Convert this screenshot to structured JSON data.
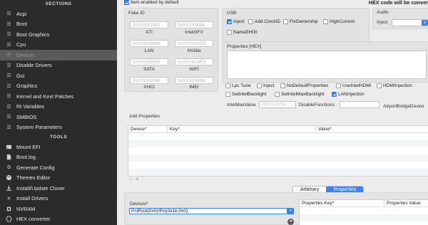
{
  "sidebar": {
    "sections_label": "SECTIONS",
    "tools_label": "TOOLS",
    "items": [
      {
        "label": "Acpi"
      },
      {
        "label": "Boot"
      },
      {
        "label": "Boot Graphics"
      },
      {
        "label": "Cpu"
      },
      {
        "label": "Devices"
      },
      {
        "label": "Disable Drivers"
      },
      {
        "label": "Gui"
      },
      {
        "label": "Graphics"
      },
      {
        "label": "Kernel and Kext Patches"
      },
      {
        "label": "Rt Variables"
      },
      {
        "label": "SMBIOS"
      },
      {
        "label": "System Parameters"
      }
    ],
    "tools": [
      {
        "label": "Mount EFI"
      },
      {
        "label": "Boot.log"
      },
      {
        "label": "Generate Config"
      },
      {
        "label": "Themes Editor"
      },
      {
        "label": "Install/Update Clover"
      },
      {
        "label": "Install Drivers"
      },
      {
        "label": "NVRAM"
      },
      {
        "label": "HEX converter"
      }
    ]
  },
  "header": {
    "item_enabled_label": "Item enabled by default",
    "hex_note": "HEX code will be conver"
  },
  "fake_id": {
    "title": "Fake ID",
    "fields": [
      {
        "placeholder": "0xXXXX1002",
        "label": "ATI"
      },
      {
        "placeholder": "0xXXXX8086",
        "label": "IntelGFX"
      },
      {
        "placeholder": "0xXXXX8086",
        "label": "LAN"
      },
      {
        "placeholder": "0xXXXX10DE",
        "label": "NVidia"
      },
      {
        "placeholder": "0xXXXX8086",
        "label": "SATA"
      },
      {
        "placeholder": "0xXXXX14E4",
        "label": "WIFI"
      },
      {
        "placeholder": "0xXXXX8086",
        "label": "XHCI"
      },
      {
        "placeholder": "0xXXXX8086",
        "label": "IMEI"
      }
    ]
  },
  "usb": {
    "title": "USB",
    "options": [
      {
        "label": "Inject",
        "checked": true
      },
      {
        "label": "Add ClockID",
        "checked": false
      },
      {
        "label": "FixOwnership",
        "checked": false
      },
      {
        "label": "HighCurrent",
        "checked": false
      },
      {
        "label": "NameEH00",
        "checked": false
      }
    ]
  },
  "audio": {
    "title": "Audio",
    "inject_label": "Inject"
  },
  "properties_hex": {
    "title": "Properties [HEX]"
  },
  "device_options": {
    "row1": [
      {
        "label": "Lpc Tune",
        "checked": false
      },
      {
        "label": "Inject",
        "checked": false
      },
      {
        "label": "NoDefaultProperties",
        "checked": false
      },
      {
        "label": "UseIntelHDMI",
        "checked": false
      },
      {
        "label": "HDMIInjection",
        "checked": false
      }
    ],
    "row2": [
      {
        "label": "SetIntelBacklight",
        "checked": false
      },
      {
        "label": "SetIntelMaxBacklight",
        "checked": false
      },
      {
        "label": "LANInjection",
        "checked": true
      }
    ],
    "intel_max_value_label": "IntelMaxValue",
    "intel_max_value_placeholder": "1808 or 0x710",
    "disable_functions_label": "DisableFunctions",
    "airport_bridge_label": "AirportBridgeDevice"
  },
  "add_properties": {
    "title": "Add Properties",
    "columns": [
      "Device*",
      "Key*",
      "Value*"
    ],
    "add_symbol": "+",
    "remove_symbol": "−"
  },
  "tabs": {
    "arbitrary": "Arbitrary",
    "properties": "Properties",
    "active": "Properties"
  },
  "properties_table": {
    "devices_header": "Devices*",
    "device_value": "PciRoot(0x0)/Pci(0x1b,0x0)",
    "properties_key_header": "Properties Key*",
    "properties_value_header": "Properties Value"
  },
  "colors": {
    "sidebar_bg": "#2b2b2b",
    "selected_item": "#5a5a5a",
    "accent": "#3b82f6"
  }
}
